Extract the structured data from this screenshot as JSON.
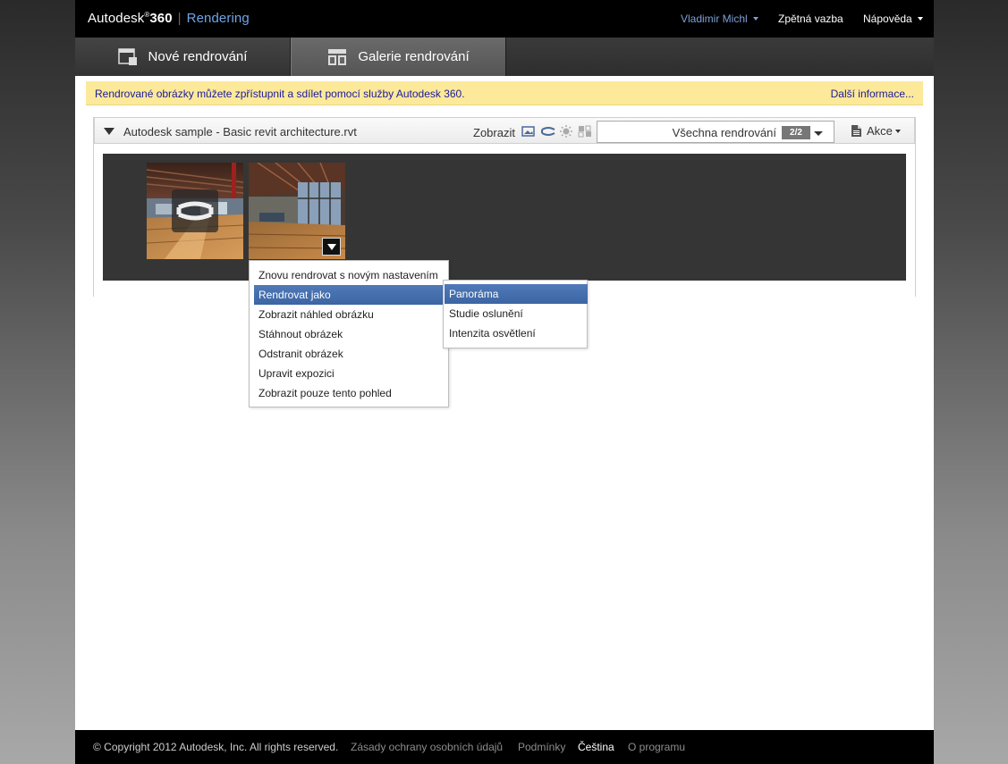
{
  "header": {
    "brand_name": "Autodesk",
    "brand_reg": "®",
    "brand_360": "360",
    "product": "Rendering",
    "user": "Vladimir Michl",
    "feedback": "Zpětná vazba",
    "help": "Nápověda"
  },
  "tabs": [
    {
      "label": "Nové rendrování",
      "icon": "new-render-icon",
      "active": false
    },
    {
      "label": "Galerie rendrování",
      "icon": "gallery-icon",
      "active": true
    }
  ],
  "notice": {
    "message": "Rendrované obrázky můžete zpřístupnit a sdílet pomocí služby Autodesk 360.",
    "more_link": "Další informace..."
  },
  "project": {
    "title": "Autodesk sample - Basic revit architecture.rvt",
    "show_label": "Zobrazit",
    "view_icons": [
      "image-icon",
      "panorama-icon",
      "sun-icon",
      "illuminance-icon"
    ],
    "filter_label": "Všechna rendrování",
    "filter_count": "2/2",
    "actions_label": "Akce"
  },
  "context_menu": {
    "items": [
      "Znovu rendrovat s novým nastavením",
      "Rendrovat jako",
      "Zobrazit náhled obrázku",
      "Stáhnout obrázek",
      "Odstranit obrázek",
      "Upravit expozici",
      "Zobrazit pouze tento pohled"
    ],
    "selected_index": 1
  },
  "submenu": {
    "items": [
      "Panoráma",
      "Studie oslunění",
      "Intenzita osvětlení"
    ],
    "selected_index": 0
  },
  "footer": {
    "copyright": "© Copyright 2012 Autodesk, Inc. All rights reserved.",
    "privacy": "Zásady ochrany osobních údajů",
    "terms": "Podmínky",
    "language": "Čeština",
    "about": "O programu"
  },
  "colors": {
    "accent_blue": "#6ea6e8",
    "menu_selected": "#3c65a3",
    "notice_bg": "#fde99a"
  }
}
